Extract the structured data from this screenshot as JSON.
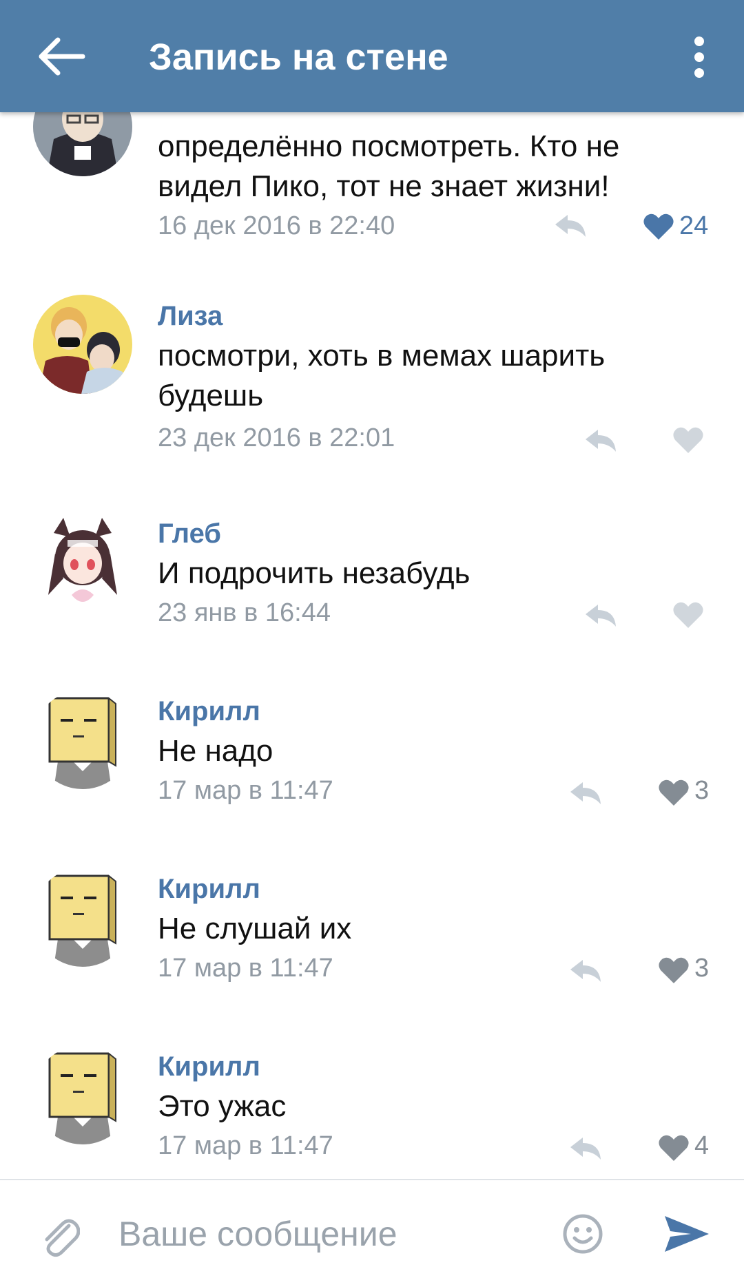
{
  "header": {
    "title": "Запись на стене"
  },
  "colors": {
    "accent": "#4a76a8",
    "bar": "#507ea8",
    "liked": "#4a76a8",
    "muted": "#919aa3"
  },
  "comments": [
    {
      "author": "",
      "text_lines": [
        "определённо посмотреть. Кто не",
        "видел Пико, тот не знает жизни!"
      ],
      "time": "16 дек 2016 в 22:40",
      "likes": "24",
      "liked": true
    },
    {
      "author": "Лиза",
      "text_lines": [
        "посмотри, хоть в мемах шарить",
        "будешь"
      ],
      "time": "23 дек 2016 в 22:01",
      "likes": "",
      "liked": false
    },
    {
      "author": "Глеб",
      "text_lines": [
        "И подрочить незабудь"
      ],
      "time": "23 янв в 16:44",
      "likes": "",
      "liked": false
    },
    {
      "author": "Кирилл",
      "text_lines": [
        "Не надо"
      ],
      "time": "17 мар в 11:47",
      "likes": "3",
      "liked": false
    },
    {
      "author": "Кирилл",
      "text_lines": [
        "Не слушай их"
      ],
      "time": "17 мар в 11:47",
      "likes": "3",
      "liked": false
    },
    {
      "author": "Кирилл",
      "text_lines": [
        "Это ужас"
      ],
      "time": "17 мар в 11:47",
      "likes": "4",
      "liked": false
    }
  ],
  "composer": {
    "placeholder": "Ваше сообщение"
  },
  "icons": {
    "back": "arrow-left-icon",
    "menu": "more-vertical-icon",
    "reply": "reply-arrow-icon",
    "like": "heart-icon",
    "attach": "paperclip-icon",
    "emoji": "smile-icon",
    "send": "send-icon"
  }
}
